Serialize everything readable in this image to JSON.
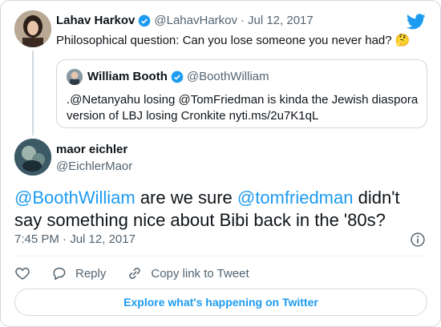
{
  "colors": {
    "accent": "#1d9bf0",
    "text": "#0f1419",
    "muted": "#536471",
    "border": "#cfd9de"
  },
  "parent_tweet": {
    "name": "Lahav Harkov",
    "handle": "@LahavHarkov",
    "separator": "·",
    "date": "Jul 12, 2017",
    "text": "Philosophical question: Can you lose someone you never had?",
    "emoji": "🤔",
    "verified": true
  },
  "quoted_tweet": {
    "name": "William Booth",
    "handle": "@BoothWilliam",
    "text": ".@Netanyahu losing @TomFriedman is kinda the Jewish diaspora version of LBJ losing Cronkite nyti.ms/2u7K1qL",
    "verified": true
  },
  "main_tweet": {
    "name": "maor eichler",
    "handle": "@EichlerMaor",
    "mention1": "@BoothWilliam",
    "text1": " are we sure ",
    "mention2": "@tomfriedman",
    "text2": " didn't say something nice about Bibi back in the '80s?",
    "time": "7:45 PM",
    "separator": "·",
    "date": "Jul 12, 2017"
  },
  "actions": {
    "like_icon": "heart-icon",
    "reply_label": "Reply",
    "reply_icon": "reply-icon",
    "copy_label": "Copy link to Tweet",
    "copy_icon": "link-icon"
  },
  "explore_button": "Explore what's happening on Twitter"
}
